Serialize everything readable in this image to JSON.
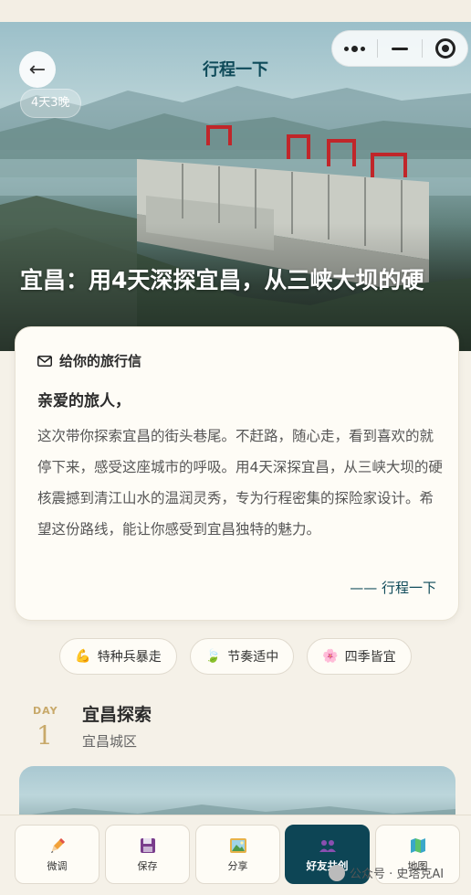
{
  "nav": {
    "back_label": "←",
    "title": "行程一下"
  },
  "hero": {
    "badge": "4天3晚",
    "title": "宜昌：用4天深探宜昌，从三峡大坝的硬"
  },
  "letter": {
    "header": "给你的旅行信",
    "greeting": "亲爱的旅人，",
    "body": "这次带你探索宜昌的街头巷尾。不赶路，随心走，看到喜欢的就停下来，感受这座城市的呼吸。用4天深探宜昌，从三峡大坝的硬核震撼到清江山水的温润灵秀，专为行程密集的探险家设计。希望这份路线，能让你感受到宜昌独特的魅力。",
    "signature": "—— 行程一下"
  },
  "tags": [
    {
      "emoji": "💪",
      "label": "特种兵暴走"
    },
    {
      "emoji": "🍃",
      "label": "节奏适中"
    },
    {
      "emoji": "🌸",
      "label": "四季皆宜"
    }
  ],
  "day": {
    "label": "DAY",
    "number": "1",
    "title": "宜昌探索",
    "subtitle": "宜昌城区"
  },
  "bottom_bar": [
    {
      "label": "微调",
      "icon": "pencil-icon"
    },
    {
      "label": "保存",
      "icon": "save-icon"
    },
    {
      "label": "分享",
      "icon": "picture-icon"
    },
    {
      "label": "好友共创",
      "icon": "people-icon"
    },
    {
      "label": "地图",
      "icon": "map-icon"
    }
  ],
  "watermark": "公众号 · 史塔克AI",
  "colors": {
    "accent": "#0d4555",
    "gold": "#c8a96a",
    "background": "#f5f1e8"
  }
}
